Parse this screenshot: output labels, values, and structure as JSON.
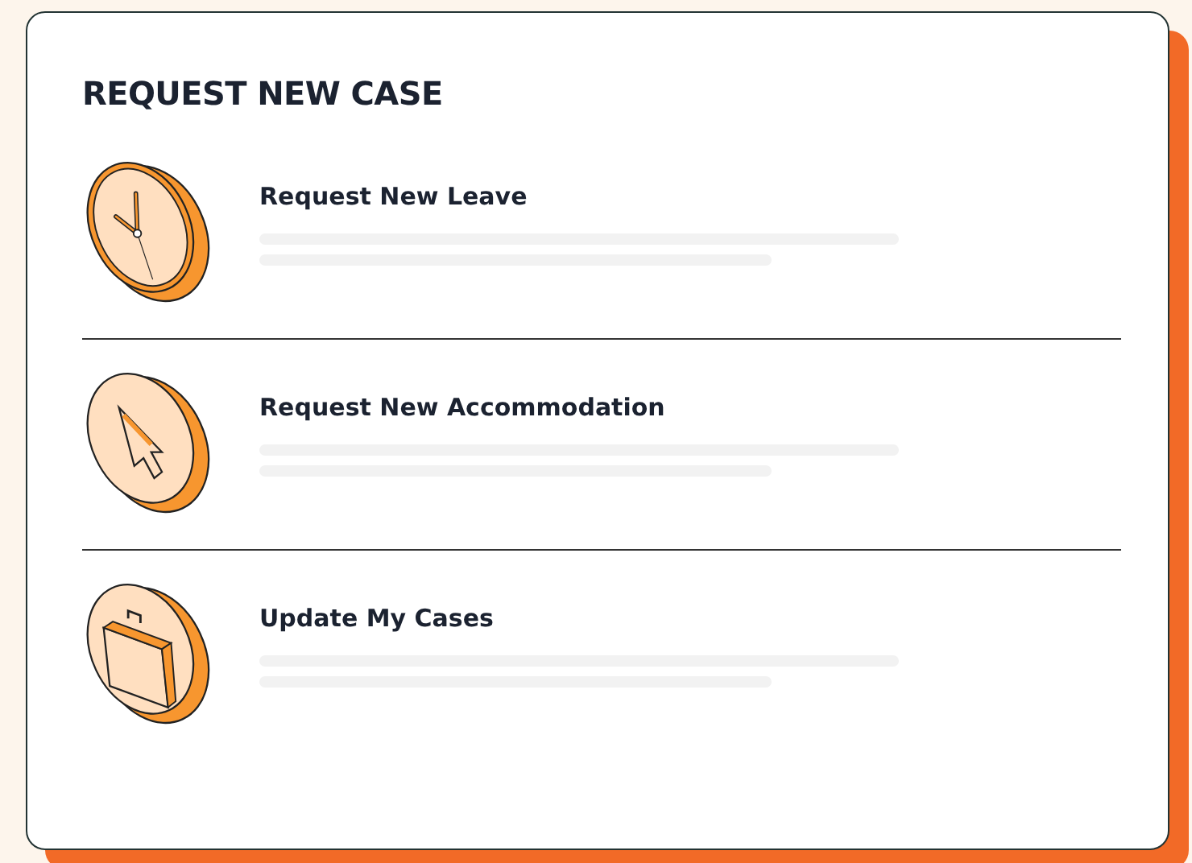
{
  "title": "REQUEST NEW CASE",
  "items": [
    {
      "kind": "clock",
      "label": "Request New Leave"
    },
    {
      "kind": "cursor",
      "label": "Request New Accommodation"
    },
    {
      "kind": "briefcase",
      "label": "Update My Cases"
    }
  ]
}
